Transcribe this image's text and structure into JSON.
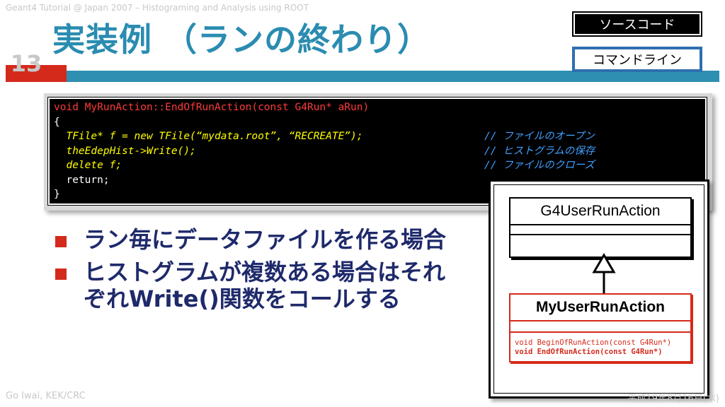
{
  "header": {
    "course_text": "Geant4 Tutorial @ Japan 2007 – Histograming and Analysis using ROOT"
  },
  "slide": {
    "number": "13",
    "title": "実装例 （ランの終わり）"
  },
  "buttons": {
    "source_code": "ソースコード",
    "command_line": "コマンドライン"
  },
  "code": {
    "line1": "void MyRunAction::EndOfRunAction(const G4Run* aRun)",
    "line2": "{",
    "line3_code": "  TFile* f = new TFile(“mydata.root”, “RECREATE”);",
    "line3_comment": "// ファイルのオープン",
    "line4_code": "  theEdepHist->Write();",
    "line4_comment": "// ヒストグラムの保存",
    "line5_code": "  delete f;",
    "line5_comment": "// ファイルのクローズ",
    "line6": "  return;",
    "line7": "}"
  },
  "bullets": [
    "ラン毎にデータファイルを作る場合",
    "ヒストグラムが複数ある場合はそれぞれWrite()関数をコールする"
  ],
  "uml": {
    "base_class": "G4UserRunAction",
    "derived_class": "MyUserRunAction",
    "method1": "void BeginOfRunAction(const G4Run*)",
    "method2": "void EndOfRunAction(const G4Run*)"
  },
  "footer": {
    "author": "Go Iwai, KEK/CRC",
    "date": "平成19年8月16日(木)"
  },
  "colors": {
    "accent_blue": "#2e8fb3",
    "accent_red": "#d42a1c",
    "title": "#2a8cb0",
    "bullet_text": "#1f2a6b"
  }
}
